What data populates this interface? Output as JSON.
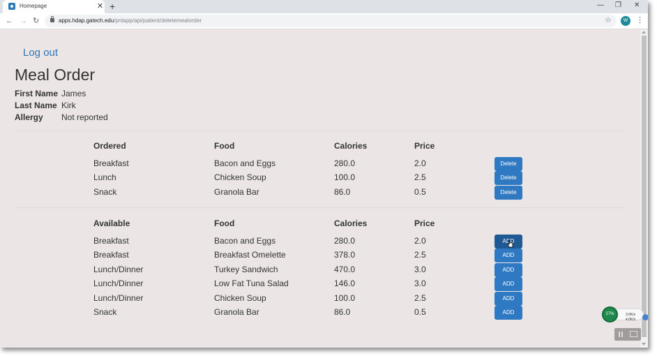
{
  "browser": {
    "tab_title": "Homepage",
    "tab_close": "✕",
    "new_tab": "+",
    "url_host": "apps.hdap.gatech.edu",
    "url_path": "/pntapp/api/patient/deletemealorder",
    "profile_initial": "W"
  },
  "page": {
    "logout_label": "Log out",
    "title": "Meal Order",
    "patient": [
      {
        "label": "First Name",
        "value": "James"
      },
      {
        "label": "Last Name",
        "value": "Kirk"
      },
      {
        "label": "Allergy",
        "value": "Not reported"
      }
    ],
    "ordered": {
      "headers": [
        "Ordered",
        "Food",
        "Calories",
        "Price"
      ],
      "button_label": "Delete",
      "rows": [
        {
          "meal": "Breakfast",
          "food": "Bacon and Eggs",
          "calories": "280.0",
          "price": "2.0"
        },
        {
          "meal": "Lunch",
          "food": "Chicken Soup",
          "calories": "100.0",
          "price": "2.5"
        },
        {
          "meal": "Snack",
          "food": "Granola Bar",
          "calories": "86.0",
          "price": "0.5"
        }
      ]
    },
    "available": {
      "headers": [
        "Available",
        "Food",
        "Calories",
        "Price"
      ],
      "button_label": "ADD",
      "rows": [
        {
          "meal": "Breakfast",
          "food": "Bacon and Eggs",
          "calories": "280.0",
          "price": "2.0"
        },
        {
          "meal": "Breakfast",
          "food": "Breakfast Omelette",
          "calories": "378.0",
          "price": "2.5"
        },
        {
          "meal": "Lunch/Dinner",
          "food": "Turkey Sandwich",
          "calories": "470.0",
          "price": "3.0"
        },
        {
          "meal": "Lunch/Dinner",
          "food": "Low Fat Tuna Salad",
          "calories": "146.0",
          "price": "3.0"
        },
        {
          "meal": "Lunch/Dinner",
          "food": "Chicken Soup",
          "calories": "100.0",
          "price": "2.5"
        },
        {
          "meal": "Snack",
          "food": "Granola Bar",
          "calories": "86.0",
          "price": "0.5"
        }
      ]
    }
  },
  "net_monitor": {
    "percent": "27%",
    "upload": "3.0K/s",
    "download": "4.0K/s"
  },
  "colors": {
    "page_bg": "#ebe6e5",
    "button_bg": "#2f79c2",
    "link": "#2f76b8"
  }
}
